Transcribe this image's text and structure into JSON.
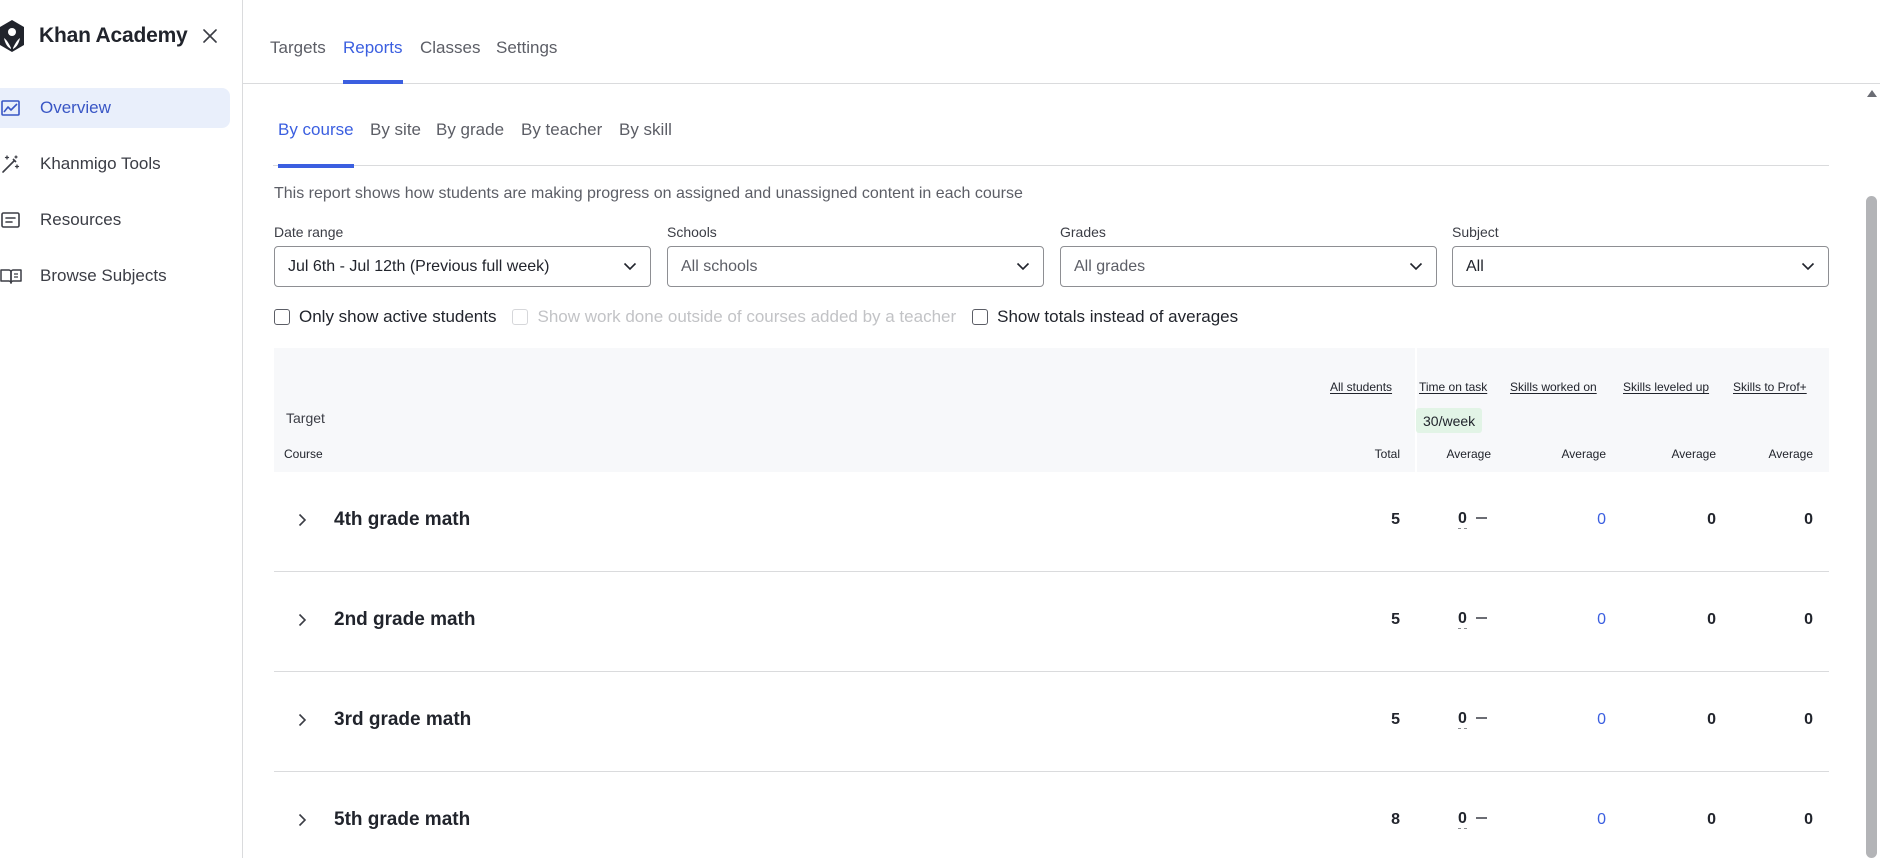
{
  "app": {
    "brand": "Khan Academy",
    "close_icon": "close-icon"
  },
  "sidebar": {
    "items": [
      {
        "label": "Overview",
        "icon": "chart-line-icon",
        "active": true
      },
      {
        "label": "Khanmigo Tools",
        "icon": "magic-wand-icon",
        "active": false
      },
      {
        "label": "Resources",
        "icon": "document-icon",
        "active": false
      },
      {
        "label": "Browse Subjects",
        "icon": "open-book-icon",
        "active": false
      }
    ]
  },
  "top_tabs": [
    "Targets",
    "Reports",
    "Classes",
    "Settings"
  ],
  "top_tabs_active": "Reports",
  "sub_tabs": [
    "By course",
    "By site",
    "By grade",
    "By teacher",
    "By skill"
  ],
  "sub_tabs_active": "By course",
  "description": "This report shows how students are making progress on assigned and unassigned content in each course",
  "filters": {
    "date_range": {
      "label": "Date range",
      "value": "Jul 6th - Jul 12th (Previous full week)"
    },
    "schools": {
      "label": "Schools",
      "value": "All schools"
    },
    "grades": {
      "label": "Grades",
      "value": "All grades"
    },
    "subject": {
      "label": "Subject",
      "value": "All"
    }
  },
  "checkboxes": {
    "active_students": {
      "label": "Only show active students",
      "checked": false,
      "disabled": false
    },
    "outside_work": {
      "label": "Show work done outside of courses added by a teacher",
      "checked": false,
      "disabled": true
    },
    "totals": {
      "label": "Show totals instead of averages",
      "checked": false,
      "disabled": false
    }
  },
  "table": {
    "columns": {
      "all_students": "All students",
      "time_on_task": "Time on task",
      "skills_worked_on": "Skills worked on",
      "skills_leveled_up": "Skills leveled up",
      "skills_to_prof": "Skills to Prof+"
    },
    "target_label": "Target",
    "target_time": "30/week",
    "course_label": "Course",
    "sub_headers": {
      "total": "Total",
      "avg_time": "Average",
      "avg_worked": "Average",
      "avg_leveled": "Average",
      "avg_prof": "Average"
    },
    "rows": [
      {
        "course": "4th grade math",
        "total": "5",
        "time": "0",
        "worked": "0",
        "leveled": "0",
        "prof": "0"
      },
      {
        "course": "2nd grade math",
        "total": "5",
        "time": "0",
        "worked": "0",
        "leveled": "0",
        "prof": "0"
      },
      {
        "course": "3rd grade math",
        "total": "5",
        "time": "0",
        "worked": "0",
        "leveled": "0",
        "prof": "0"
      },
      {
        "course": "5th grade math",
        "total": "8",
        "time": "0",
        "worked": "0",
        "leveled": "0",
        "prof": "0"
      }
    ]
  },
  "colors": {
    "accent": "#3b5fe0",
    "nav_active_bg": "#e9effb",
    "target_badge_bg": "#e2f4e6",
    "header_bg": "#f7f8fa"
  }
}
